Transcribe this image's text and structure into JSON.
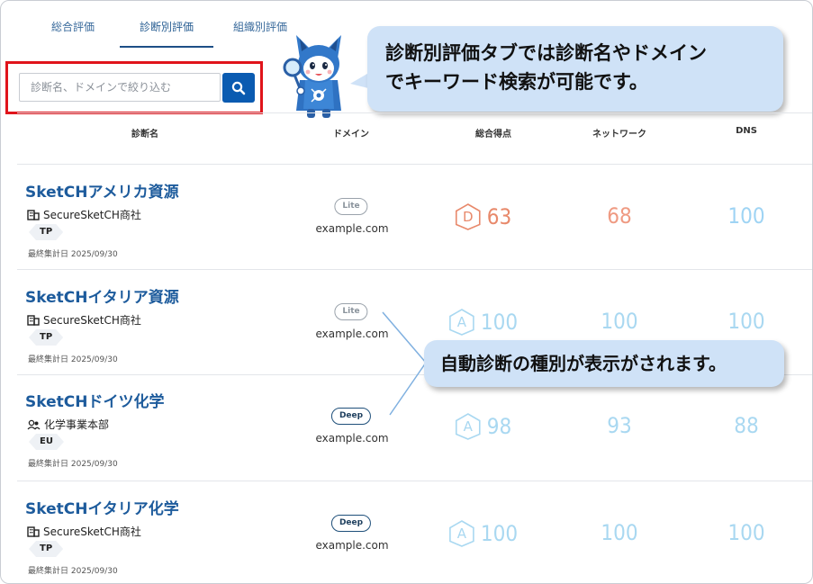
{
  "tabs": [
    "総合評価",
    "診断別評価",
    "組織別評価"
  ],
  "search": {
    "placeholder": "診断名、ドメインで絞り込む"
  },
  "callouts": {
    "search_tip": [
      "診断別評価タブでは診断名やドメイン",
      "でキーワード検索が可能です。"
    ],
    "type_tip": "自動診断の種別が表示がされます。"
  },
  "table": {
    "headers": {
      "name": "診断名",
      "domain": "ドメイン",
      "total": "総合得点",
      "network": "ネットワーク",
      "dns": "DNS"
    },
    "rows": [
      {
        "name": "SketCHアメリカ資源",
        "org_icon": "building-icon",
        "org": "SecureSketCH商社",
        "region": "TP",
        "date": "最終集計日 2025/09/30",
        "type": "Lite",
        "domain": "example.com",
        "grade": "D",
        "total": "63",
        "network": "68",
        "dns": "100",
        "grade_color": "#e8896b",
        "network_color": "#ef9a82",
        "dns_color": "#9fd4f4"
      },
      {
        "name": "SketCHイタリア資源",
        "org_icon": "building-icon",
        "org": "SecureSketCH商社",
        "region": "TP",
        "date": "最終集計日 2025/09/30",
        "type": "Lite",
        "domain": "example.com",
        "grade": "A",
        "total": "100",
        "network": "100",
        "dns": "100",
        "grade_color": "#a9d8f1",
        "network_color": "#a9d8f1",
        "dns_color": "#a9d8f1"
      },
      {
        "name": "SketCHドイツ化学",
        "org_icon": "people-icon",
        "org": "化学事業本部",
        "region": "EU",
        "date": "最終集計日 2025/09/30",
        "type": "Deep",
        "domain": "example.com",
        "grade": "A",
        "total": "98",
        "network": "93",
        "dns": "88",
        "grade_color": "#a9d8f1",
        "network_color": "#a9d8f1",
        "dns_color": "#a9d8f1"
      },
      {
        "name": "SketCHイタリア化学",
        "org_icon": "building-icon",
        "org": "SecureSketCH商社",
        "region": "TP",
        "date": "最終集計日 2025/09/30",
        "type": "Deep",
        "domain": "example.com",
        "grade": "A",
        "total": "100",
        "network": "100",
        "dns": "100",
        "grade_color": "#a9d8f1",
        "network_color": "#a9d8f1",
        "dns_color": "#a9d8f1"
      }
    ]
  }
}
